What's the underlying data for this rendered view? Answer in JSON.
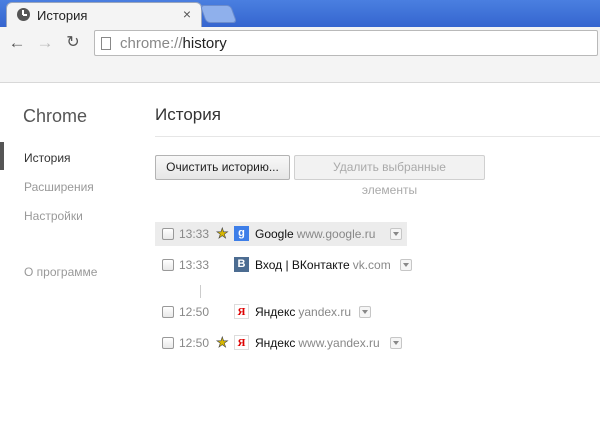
{
  "tab": {
    "title": "История",
    "close": "×"
  },
  "toolbar": {
    "back": "←",
    "forward": "→",
    "reload": "↻",
    "url_scheme": "chrome://",
    "url_host": "history"
  },
  "sidebar": {
    "brand": "Chrome",
    "items": [
      {
        "label": "История",
        "active": true
      },
      {
        "label": "Расширения",
        "active": false
      },
      {
        "label": "Настройки",
        "active": false
      },
      {
        "label": "О программе",
        "active": false
      }
    ]
  },
  "main": {
    "title": "История",
    "clear_button": "Очистить историю...",
    "remove_button": "Удалить выбранные элементы"
  },
  "entries": [
    {
      "time": "13:33",
      "starred": true,
      "favicon": "g",
      "title": "Google",
      "domain": "www.google.ru"
    },
    {
      "time": "13:33",
      "starred": false,
      "favicon": "B",
      "title": "Вход | ВКонтакте",
      "domain": "vk.com"
    },
    {
      "time": "12:50",
      "starred": false,
      "favicon": "Я",
      "title": "Яндекс",
      "domain": "yandex.ru"
    },
    {
      "time": "12:50",
      "starred": true,
      "favicon": "Я",
      "title": "Яндекс",
      "domain": "www.yandex.ru"
    }
  ],
  "icons": {
    "star": "★",
    "star_icon_name": "star-icon",
    "page_icon_name": "page-icon"
  },
  "colors": {
    "tabstrip": "#3a6fd6",
    "google_favicon": "#3d7ee8",
    "vk_favicon": "#4c6c91",
    "yandex_favicon": "#dd0000"
  }
}
